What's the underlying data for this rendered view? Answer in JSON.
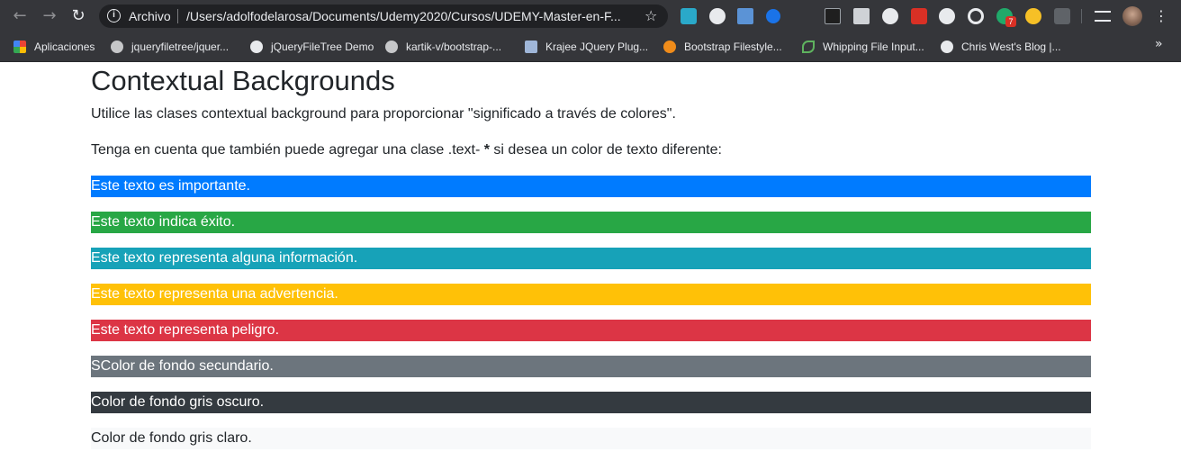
{
  "browser": {
    "url_chip": "Archivo",
    "url": "/Users/adolfodelarosa/Documents/Udemy2020/Cursos/UDEMY-Master-en-F...",
    "extension_badge": "7",
    "bookmarks": [
      {
        "label": "Aplicaciones",
        "icon": "apps-grid-icon"
      },
      {
        "label": "jqueryfiletree/jquer...",
        "icon": "github-icon"
      },
      {
        "label": "jQueryFileTree Demo",
        "icon": "globe-icon"
      },
      {
        "label": "kartik-v/bootstrap-...",
        "icon": "github-icon"
      },
      {
        "label": "Krajee JQuery Plug...",
        "icon": "krajee-k-icon"
      },
      {
        "label": "Bootstrap Filestyle...",
        "icon": "orange-apple-icon"
      },
      {
        "label": "Whipping File Input...",
        "icon": "leaf-icon"
      },
      {
        "label": "Chris West's Blog |...",
        "icon": "globe-icon"
      }
    ]
  },
  "page": {
    "title": "Contextual Backgrounds",
    "intro": "Utilice las clases contextual background para proporcionar \"significado a través de colores\".",
    "note_before": "Tenga en cuenta que también puede agregar una clase .text- ",
    "note_bold": "*",
    "note_after": " si desea un color de texto diferente:",
    "rows": [
      {
        "text": "Este texto es importante.",
        "bg": "#007bff",
        "color": "#ffffff"
      },
      {
        "text": "Este texto indica éxito.",
        "bg": "#28a745",
        "color": "#ffffff"
      },
      {
        "text": "Este texto representa alguna información.",
        "bg": "#17a2b8",
        "color": "#ffffff"
      },
      {
        "text": "Este texto representa una advertencia.",
        "bg": "#ffc107",
        "color": "#ffffff"
      },
      {
        "text": "Este texto representa peligro.",
        "bg": "#dc3545",
        "color": "#ffffff"
      },
      {
        "text": "SColor de fondo secundario.",
        "bg": "#6c757d",
        "color": "#ffffff"
      },
      {
        "text": "Color de fondo gris oscuro.",
        "bg": "#343a40",
        "color": "#ffffff"
      },
      {
        "text": "Color de fondo gris claro.",
        "bg": "#f8f9fa",
        "color": "#212529"
      }
    ]
  }
}
